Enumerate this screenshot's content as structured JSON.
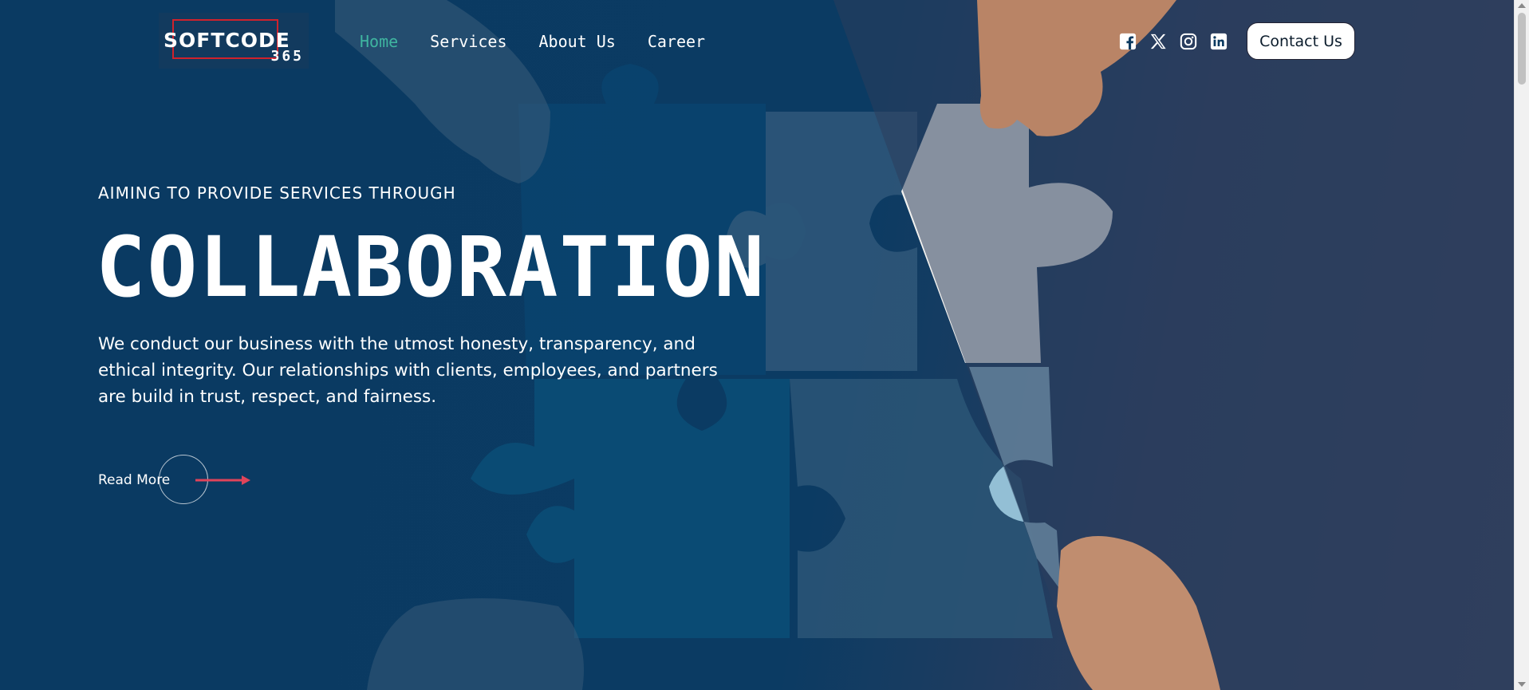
{
  "brand": {
    "logo_text": "SOFTCODE",
    "logo_sub": "365",
    "accent_red": "#d0222c"
  },
  "nav": {
    "items": [
      {
        "label": "Home",
        "active": true
      },
      {
        "label": "Services",
        "active": false
      },
      {
        "label": "About Us",
        "active": false
      },
      {
        "label": "Career",
        "active": false
      }
    ],
    "active_color": "#3fb5a0"
  },
  "socials": [
    {
      "icon": "facebook-icon"
    },
    {
      "icon": "x-twitter-icon"
    },
    {
      "icon": "instagram-icon"
    },
    {
      "icon": "linkedin-icon"
    }
  ],
  "header": {
    "contact_label": "Contact Us"
  },
  "hero": {
    "eyebrow": "AIMING TO PROVIDE SERVICES THROUGH",
    "headline": "COLLABORATION",
    "description": "We conduct our business with the utmost honesty, transparency, and ethical integrity. Our relationships with clients, employees, and partners are build in trust, respect, and fairness.",
    "read_more_label": "Read More",
    "arrow_color": "#e0445a",
    "background_color": "#0b3a60"
  }
}
